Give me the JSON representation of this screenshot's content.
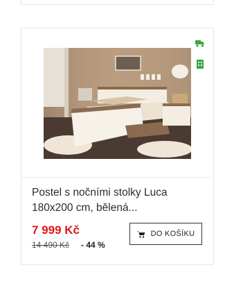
{
  "product": {
    "title": "Postel s nočními stolky Luca 180x200 cm, bělená...",
    "price": "7 999 Kč",
    "old_price": "14 490 Kč",
    "discount": "- 44 %",
    "cart_label": "DO KOŠÍKU",
    "icons": {
      "delivery": "truck-icon",
      "availability": "calendar-icon",
      "cart": "cart-icon"
    },
    "colors": {
      "price": "#e3141c",
      "accent_icon": "#3aa63f"
    }
  }
}
